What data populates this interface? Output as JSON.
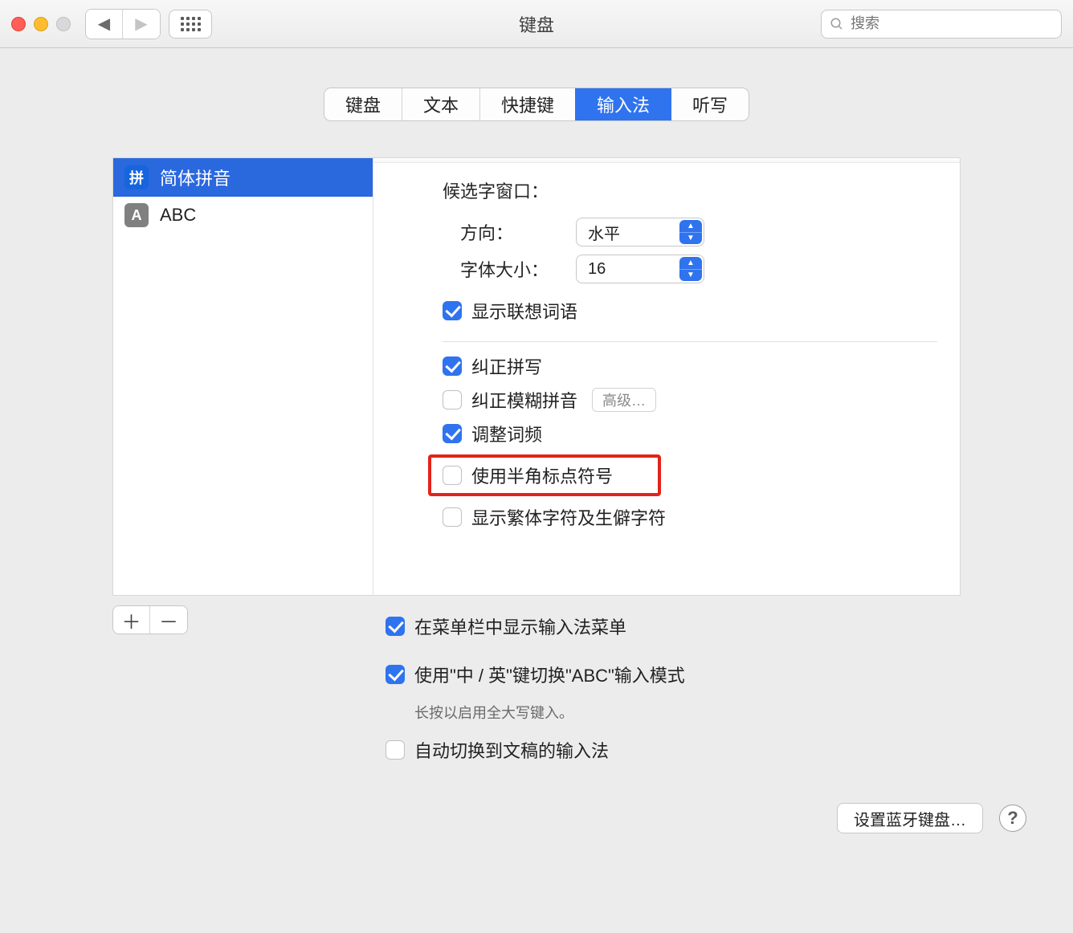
{
  "window": {
    "title": "键盘"
  },
  "toolbar": {
    "search_placeholder": "搜索"
  },
  "tabs": [
    "键盘",
    "文本",
    "快捷键",
    "输入法",
    "听写"
  ],
  "tabs_active_index": 3,
  "sources": [
    {
      "badge": "拼",
      "badge_kind": "pin",
      "label": "简体拼音",
      "selected": true
    },
    {
      "badge": "A",
      "badge_kind": "abc",
      "label": "ABC",
      "selected": false
    }
  ],
  "candidate": {
    "section_title": "候选字窗口：",
    "rows": {
      "direction": {
        "label": "方向：",
        "value": "水平"
      },
      "font_size": {
        "label": "字体大小：",
        "value": "16"
      }
    },
    "show_assoc": {
      "label": "显示联想词语",
      "checked": true
    }
  },
  "spelling": {
    "correct": {
      "label": "纠正拼写",
      "checked": true
    },
    "fuzzy": {
      "label": "纠正模糊拼音",
      "checked": false,
      "advanced_btn": "高级…"
    },
    "freq": {
      "label": "调整词频",
      "checked": true
    },
    "halfwidth": {
      "label": "使用半角标点符号",
      "checked": false
    },
    "trad": {
      "label": "显示繁体字符及生僻字符",
      "checked": false
    }
  },
  "global": {
    "menu_bar": {
      "label": "在菜单栏中显示输入法菜单",
      "checked": true
    },
    "toggle_abc": {
      "label": "使用\"中 / 英\"键切换\"ABC\"输入模式",
      "checked": true,
      "hint": "长按以启用全大写键入。"
    },
    "auto_switch": {
      "label": "自动切换到文稿的输入法",
      "checked": false
    }
  },
  "buttons": {
    "bluetooth": "设置蓝牙键盘…"
  }
}
